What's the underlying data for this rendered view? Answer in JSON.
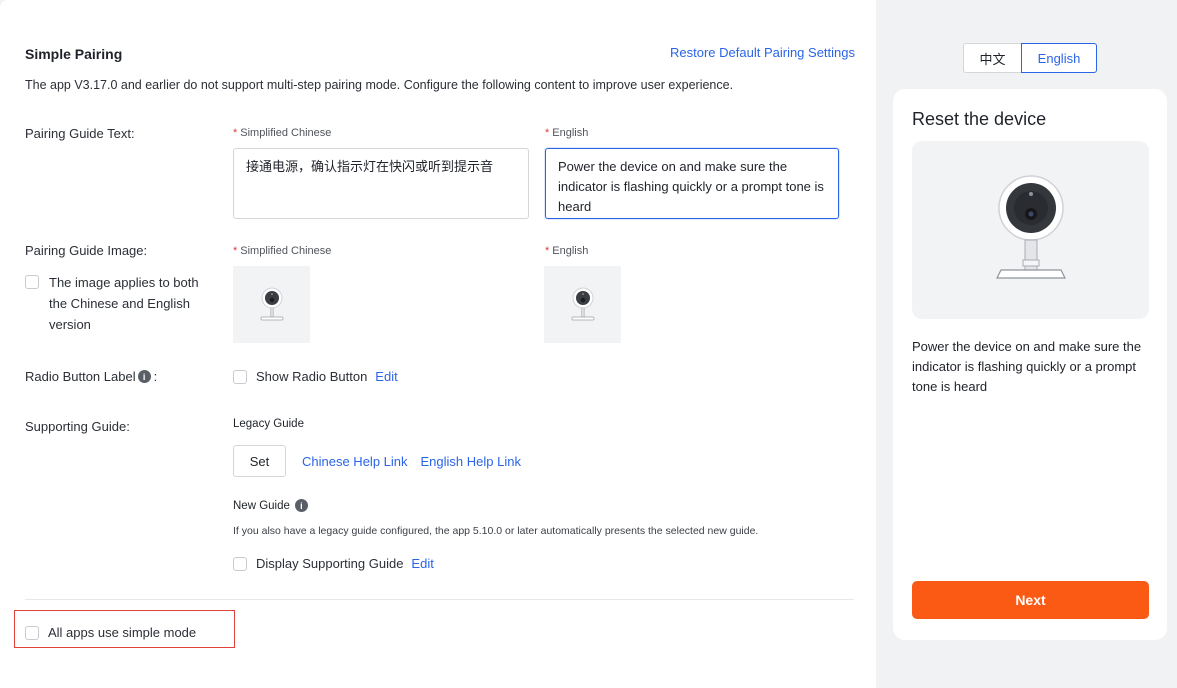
{
  "main": {
    "title": "Simple Pairing",
    "restore_link": "Restore Default Pairing Settings",
    "description": "The app V3.17.0 and earlier do not support multi-step pairing mode. Configure the following content to improve user experience.",
    "pairing_text": {
      "label": "Pairing Guide Text",
      "zh_label": "Simplified Chinese",
      "en_label": "English",
      "zh_value": "接通电源，确认指示灯在快闪或听到提示音",
      "en_value": "Power the device on and make sure the indicator is flashing quickly or a prompt tone is heard"
    },
    "pairing_image": {
      "label": "Pairing Guide Image",
      "zh_label": "Simplified Chinese",
      "en_label": "English",
      "both_checkbox": "The image applies to both the Chinese and English version"
    },
    "radio": {
      "label": "Radio Button Label",
      "checkbox_label": "Show Radio Button",
      "edit": "Edit"
    },
    "supporting": {
      "label": "Supporting Guide",
      "legacy_title": "Legacy Guide",
      "set_button": "Set",
      "zh_link": "Chinese Help Link",
      "en_link": "English Help Link",
      "new_title": "New Guide",
      "new_desc": "If you also have a legacy guide configured, the app 5.10.0 or later automatically presents the selected new guide.",
      "display_checkbox": "Display Supporting Guide",
      "edit": "Edit"
    },
    "simple_mode_checkbox": "All apps use simple mode",
    "colon": ":"
  },
  "preview": {
    "lang_zh": "中文",
    "lang_en": "English",
    "selected_lang": "English",
    "card_title": "Reset the device",
    "card_desc": "Power the device on and make sure the indicator is flashing quickly or a prompt tone is heard",
    "next_button": "Next"
  },
  "colors": {
    "accent": "#2a65e8",
    "next_button": "#fa5a14",
    "required": "#e03a3a",
    "highlight_box": "#e0413a"
  }
}
